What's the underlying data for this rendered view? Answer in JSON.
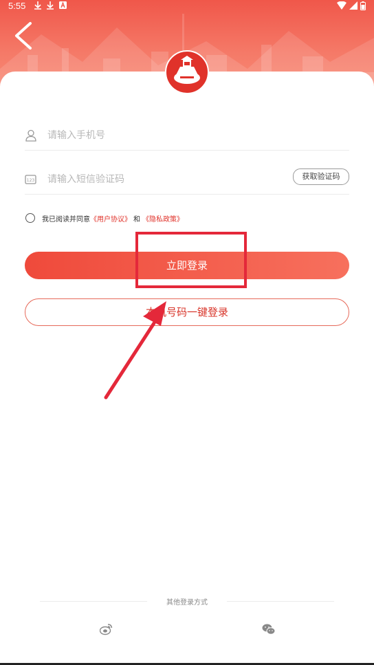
{
  "status_bar": {
    "time": "5:55"
  },
  "form": {
    "phone_placeholder": "请输入手机号",
    "code_placeholder": "请输入短信验证码",
    "get_code_label": "获取验证码"
  },
  "agreement": {
    "prefix": "我已阅读并同意",
    "user_agreement": "《用户协议》",
    "and": "和",
    "privacy_policy": "《隐私政策》"
  },
  "buttons": {
    "login_label": "立即登录",
    "one_key_label": "本机号码一键登录"
  },
  "other_login": {
    "label": "其他登录方式",
    "methods": [
      "weibo-icon",
      "wechat-icon"
    ]
  },
  "colors": {
    "accent": "#e0322a",
    "header": "#f0574a"
  }
}
